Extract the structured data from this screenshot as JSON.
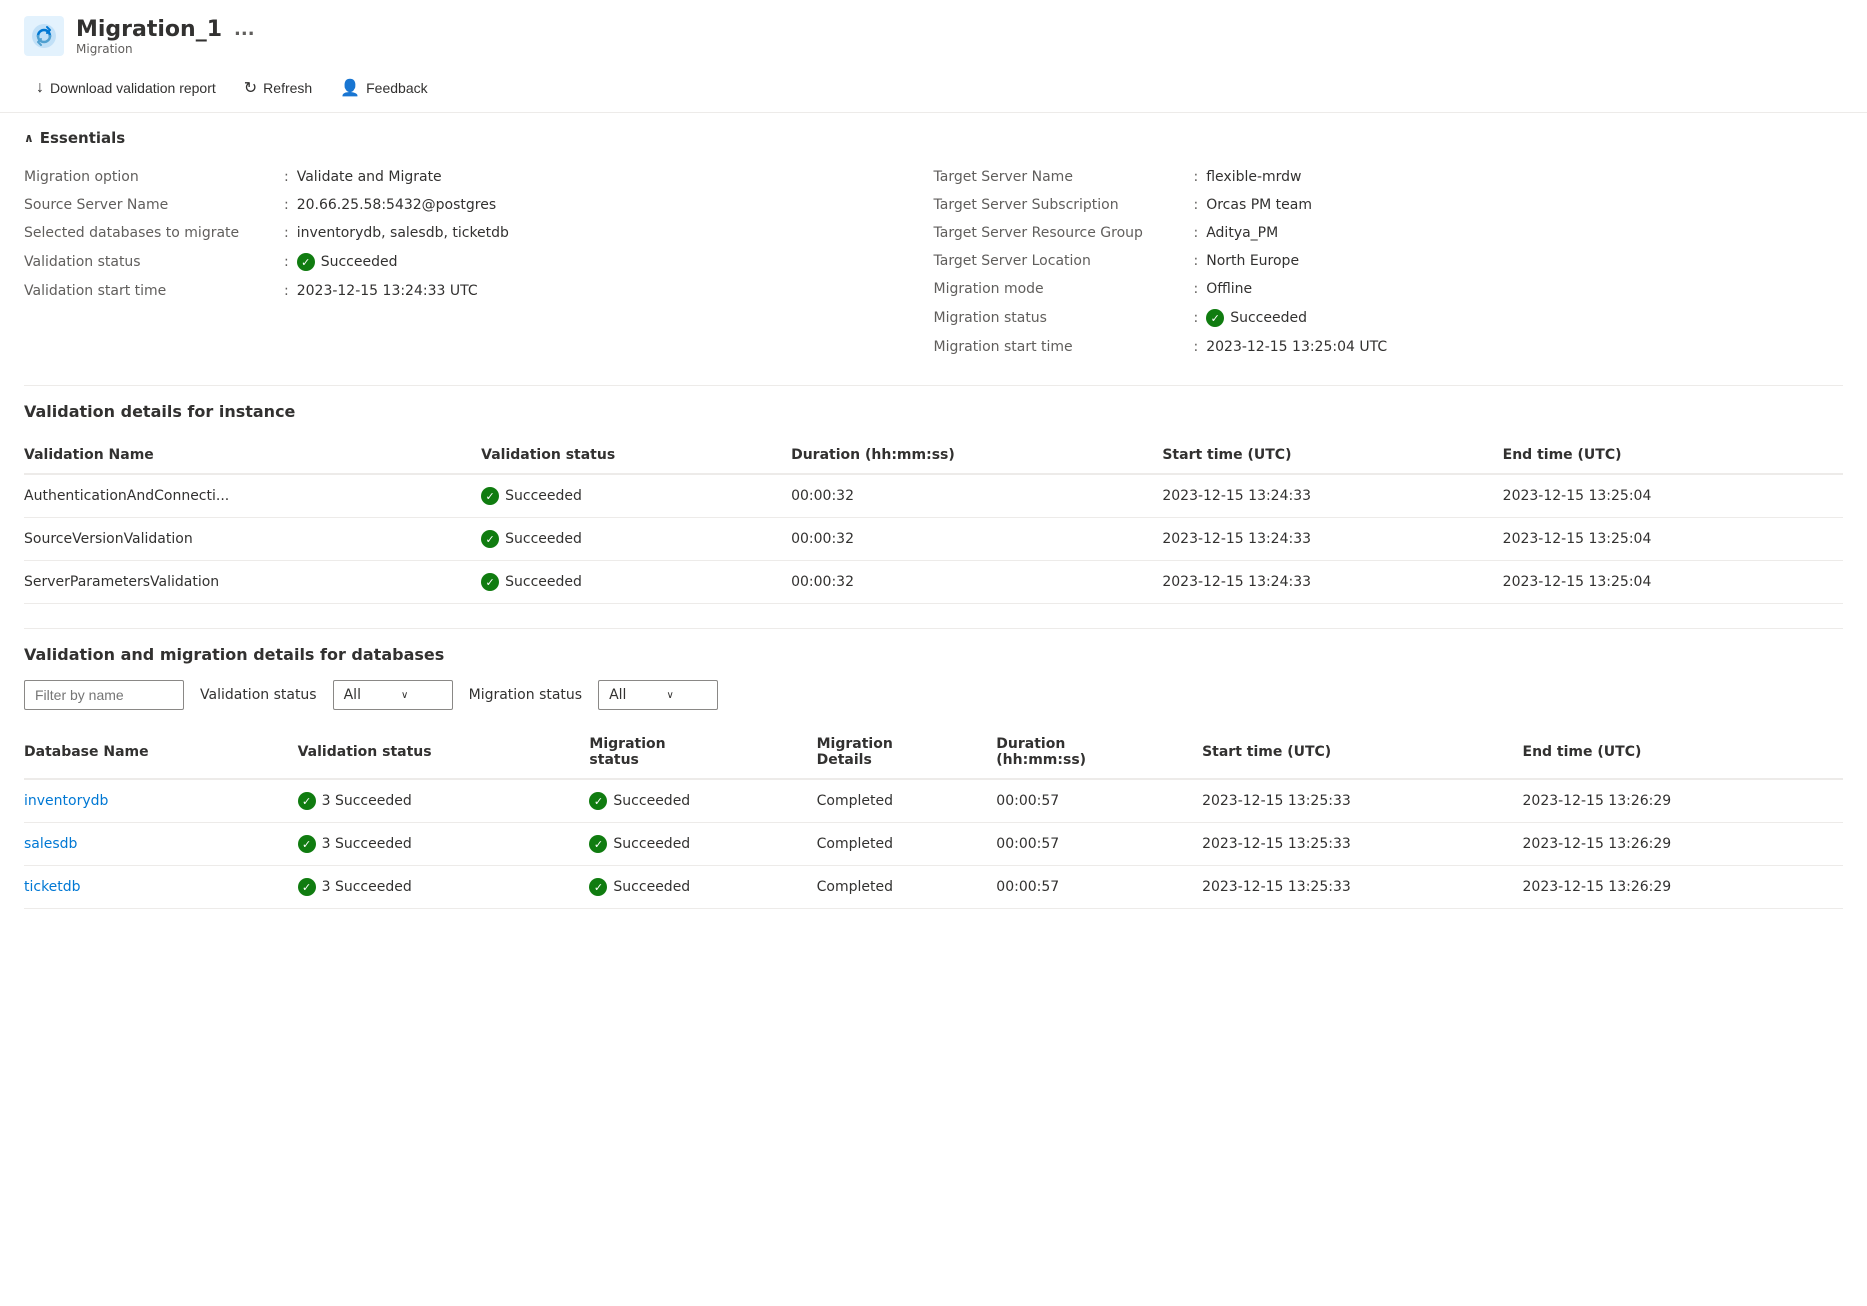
{
  "header": {
    "title": "Migration_1",
    "subtitle": "Migration",
    "ellipsis": "...",
    "icon_label": "migration-icon"
  },
  "toolbar": {
    "download_label": "Download validation report",
    "refresh_label": "Refresh",
    "feedback_label": "Feedback"
  },
  "essentials": {
    "section_label": "Essentials",
    "left": [
      {
        "label": "Migration option",
        "value": "Validate and Migrate"
      },
      {
        "label": "Source Server Name",
        "value": "20.66.25.58:5432@postgres"
      },
      {
        "label": "Selected databases to migrate",
        "value": "inventorydb, salesdb, ticketdb"
      },
      {
        "label": "Validation status",
        "value": "Succeeded",
        "has_icon": true
      },
      {
        "label": "Validation start time",
        "value": "2023-12-15 13:24:33 UTC"
      }
    ],
    "right": [
      {
        "label": "Target Server Name",
        "value": "flexible-mrdw"
      },
      {
        "label": "Target Server Subscription",
        "value": "Orcas PM team"
      },
      {
        "label": "Target Server Resource Group",
        "value": "Aditya_PM"
      },
      {
        "label": "Target Server Location",
        "value": "North Europe"
      },
      {
        "label": "Migration mode",
        "value": "Offline"
      },
      {
        "label": "Migration status",
        "value": "Succeeded",
        "has_icon": true
      },
      {
        "label": "Migration start time",
        "value": "2023-12-15 13:25:04 UTC"
      }
    ]
  },
  "validation_instance": {
    "section_title": "Validation details for instance",
    "columns": [
      "Validation Name",
      "Validation status",
      "Duration (hh:mm:ss)",
      "Start time (UTC)",
      "End time (UTC)"
    ],
    "rows": [
      {
        "name": "AuthenticationAndConnecti...",
        "status": "Succeeded",
        "duration": "00:00:32",
        "start": "2023-12-15 13:24:33",
        "end": "2023-12-15 13:25:04"
      },
      {
        "name": "SourceVersionValidation",
        "status": "Succeeded",
        "duration": "00:00:32",
        "start": "2023-12-15 13:24:33",
        "end": "2023-12-15 13:25:04"
      },
      {
        "name": "ServerParametersValidation",
        "status": "Succeeded",
        "duration": "00:00:32",
        "start": "2023-12-15 13:24:33",
        "end": "2023-12-15 13:25:04"
      }
    ]
  },
  "validation_databases": {
    "section_title": "Validation and migration details for databases",
    "filter": {
      "placeholder": "Filter by name",
      "validation_label": "Validation status",
      "validation_value": "All",
      "migration_label": "Migration status",
      "migration_value": "All"
    },
    "columns": [
      "Database Name",
      "Validation status",
      "Migration status",
      "Migration Details",
      "Duration (hh:mm:ss)",
      "Start time (UTC)",
      "End time (UTC)"
    ],
    "rows": [
      {
        "name": "inventorydb",
        "validation_status": "3 Succeeded",
        "migration_status": "Succeeded",
        "migration_details": "Completed",
        "duration": "00:00:57",
        "start": "2023-12-15 13:25:33",
        "end": "2023-12-15 13:26:29"
      },
      {
        "name": "salesdb",
        "validation_status": "3 Succeeded",
        "migration_status": "Succeeded",
        "migration_details": "Completed",
        "duration": "00:00:57",
        "start": "2023-12-15 13:25:33",
        "end": "2023-12-15 13:26:29"
      },
      {
        "name": "ticketdb",
        "validation_status": "3 Succeeded",
        "migration_status": "Succeeded",
        "migration_details": "Completed",
        "duration": "00:00:57",
        "start": "2023-12-15 13:25:33",
        "end": "2023-12-15 13:26:29"
      }
    ]
  }
}
